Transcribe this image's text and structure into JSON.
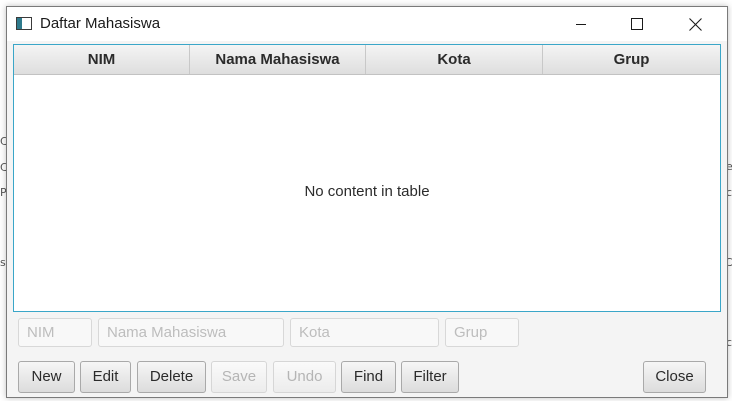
{
  "window": {
    "title": "Daftar Mahasiswa",
    "controls": {
      "minimize_icon": "minimize-icon",
      "maximize_icon": "maximize-icon",
      "close_icon": "close-icon"
    }
  },
  "table": {
    "columns": [
      "NIM",
      "Nama Mahasiswa",
      "Kota",
      "Grup"
    ],
    "rows": [],
    "empty_message": "No content in table",
    "accent_border": "#3aa6c8"
  },
  "form": {
    "nim_placeholder": "NIM",
    "nama_placeholder": "Nama Mahasiswa",
    "kota_placeholder": "Kota",
    "grup_placeholder": "Grup"
  },
  "toolbar": {
    "new_label": "New",
    "edit_label": "Edit",
    "delete_label": "Delete",
    "save_label": "Save",
    "undo_label": "Undo",
    "find_label": "Find",
    "filter_label": "Filter",
    "close_label": "Close"
  },
  "background": {
    "frag_left_1": "C",
    "frag_left_2": "C",
    "frag_left_3": "P",
    "frag_left_4": "s",
    "frag_right_1": "e",
    "frag_right_2": "c",
    "frag_right_3": "C",
    "frag_right_4": "c"
  }
}
